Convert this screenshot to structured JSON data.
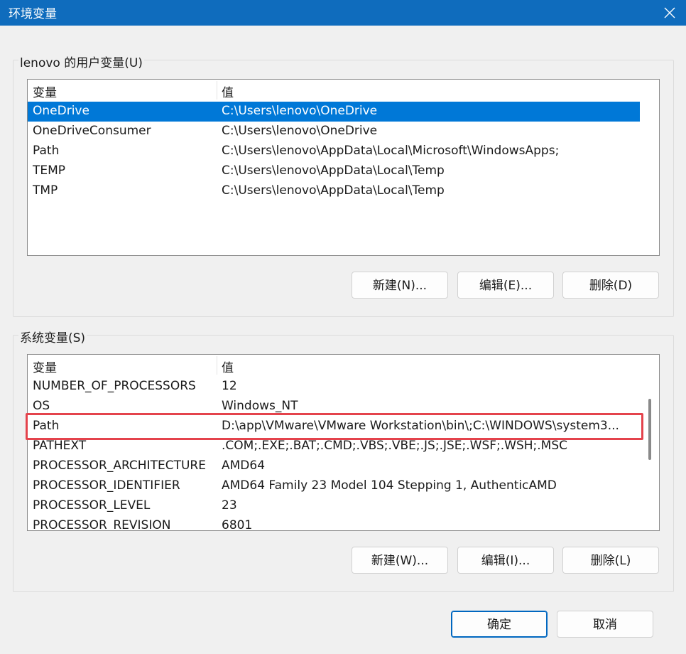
{
  "window": {
    "title": "环境变量",
    "close_icon": "close-icon"
  },
  "user_vars": {
    "group_label": "lenovo 的用户变量(U)",
    "columns": [
      "变量",
      "值"
    ],
    "rows": [
      {
        "name": "OneDrive",
        "value": "C:\\Users\\lenovo\\OneDrive"
      },
      {
        "name": "OneDriveConsumer",
        "value": "C:\\Users\\lenovo\\OneDrive"
      },
      {
        "name": "Path",
        "value": "C:\\Users\\lenovo\\AppData\\Local\\Microsoft\\WindowsApps;"
      },
      {
        "name": "TEMP",
        "value": "C:\\Users\\lenovo\\AppData\\Local\\Temp"
      },
      {
        "name": "TMP",
        "value": "C:\\Users\\lenovo\\AppData\\Local\\Temp"
      }
    ],
    "selected_row": "OneDrive",
    "new_label": "新建(N)...",
    "edit_label": "编辑(E)...",
    "delete_label": "删除(D)"
  },
  "system_vars": {
    "group_label": "系统变量(S)",
    "columns": [
      "变量",
      "值"
    ],
    "rows": [
      {
        "name": "NUMBER_OF_PROCESSORS",
        "value": "12"
      },
      {
        "name": "OS",
        "value": "Windows_NT"
      },
      {
        "name": "Path",
        "value": "D:\\app\\VMware\\VMware Workstation\\bin\\;C:\\WINDOWS\\system3..."
      },
      {
        "name": "PATHEXT",
        "value": ".COM;.EXE;.BAT;.CMD;.VBS;.VBE;.JS;.JSE;.WSF;.WSH;.MSC"
      },
      {
        "name": "PROCESSOR_ARCHITECTURE",
        "value": "AMD64"
      },
      {
        "name": "PROCESSOR_IDENTIFIER",
        "value": "AMD64 Family 23 Model 104 Stepping 1, AuthenticAMD"
      },
      {
        "name": "PROCESSOR_LEVEL",
        "value": "23"
      },
      {
        "name": "PROCESSOR_REVISION",
        "value": "6801"
      }
    ],
    "highlighted_row": "Path",
    "highlight_color": "#e4434c",
    "new_label": "新建(W)...",
    "edit_label": "编辑(I)...",
    "delete_label": "删除(L)"
  },
  "footer": {
    "ok_label": "确定",
    "cancel_label": "取消"
  },
  "colors": {
    "titlebar": "#0f6cbd",
    "selection": "#0078d7",
    "dialog_bg": "#f0f0f0"
  }
}
